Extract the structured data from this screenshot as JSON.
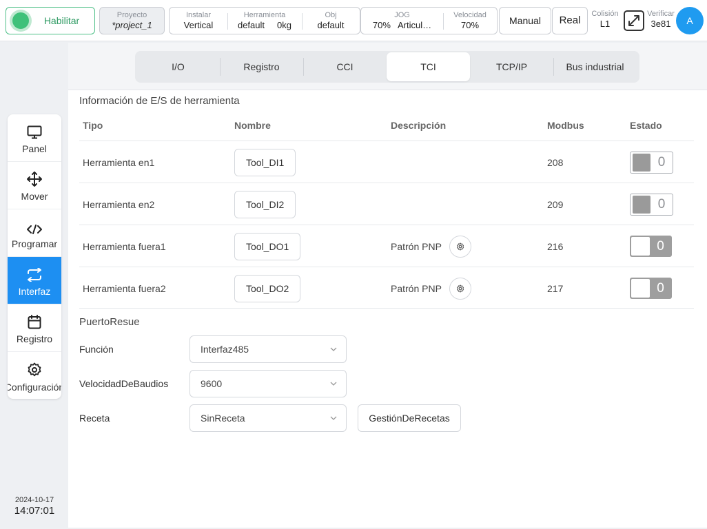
{
  "topbar": {
    "enable_label": "Habilitar",
    "project": {
      "label": "Proyecto",
      "value": "*project_1"
    },
    "install": [
      {
        "label": "Instalar",
        "value": "Vertical"
      },
      {
        "label": "Herramienta",
        "value": "default     0kg"
      },
      {
        "label": "Obj",
        "value": "default"
      }
    ],
    "jog": [
      {
        "label": "JOG",
        "value": "70%   Articul…"
      },
      {
        "label": "Velocidad",
        "value": "70%"
      }
    ],
    "mode_manual": "Manual",
    "mode_real": "Real",
    "collision": {
      "label": "Colisión",
      "value": "L1"
    },
    "verify": {
      "label": "Verificar",
      "value": "3e81"
    },
    "avatar": "A",
    "icons": {
      "fullscreen": "expand-arrows-icon"
    }
  },
  "sidebar": {
    "items": [
      {
        "label": "Panel",
        "icon": "monitor-icon"
      },
      {
        "label": "Mover",
        "icon": "move-arrows-icon"
      },
      {
        "label": "Programar",
        "icon": "code-icon"
      },
      {
        "label": "Interfaz",
        "icon": "swap-arrows-icon",
        "active": true
      },
      {
        "label": "Registro",
        "icon": "calendar-icon"
      },
      {
        "label": "Configuración",
        "icon": "gear-icon"
      }
    ],
    "date": "2024-10-17",
    "time": "14:07:01",
    "active_color": "#1d8ff2"
  },
  "tabs": [
    "I/O",
    "Registro",
    "CCI",
    "TCI",
    "TCP/IP",
    "Bus industrial"
  ],
  "active_tab": "TCI",
  "io_section": {
    "title": "Información de E/S de herramienta",
    "headers": [
      "Tipo",
      "Nombre",
      "Descripción",
      "Modbus",
      "Estado"
    ],
    "rows": [
      {
        "type": "Herramienta en1",
        "name": "Tool_DI1",
        "desc": "",
        "modbus": "208",
        "state": "0",
        "kind": "input"
      },
      {
        "type": "Herramienta en2",
        "name": "Tool_DI2",
        "desc": "",
        "modbus": "209",
        "state": "0",
        "kind": "input"
      },
      {
        "type": "Herramienta fuera1",
        "name": "Tool_DO1",
        "desc": "Patrón PNP",
        "modbus": "216",
        "state": "0",
        "kind": "output"
      },
      {
        "type": "Herramienta fuera2",
        "name": "Tool_DO2",
        "desc": "Patrón PNP",
        "modbus": "217",
        "state": "0",
        "kind": "output"
      }
    ]
  },
  "serial_section": {
    "title": "PuertoResue",
    "function": {
      "label": "Función",
      "value": "Interfaz485"
    },
    "baud": {
      "label": "VelocidadDeBaudios",
      "value": "9600"
    },
    "recipe": {
      "label": "Receta",
      "value": "SinReceta",
      "button": "GestiónDeRecetas"
    }
  },
  "colors": {
    "enable_green": "#3fc17a",
    "avatar_blue": "#1f9bf0"
  }
}
